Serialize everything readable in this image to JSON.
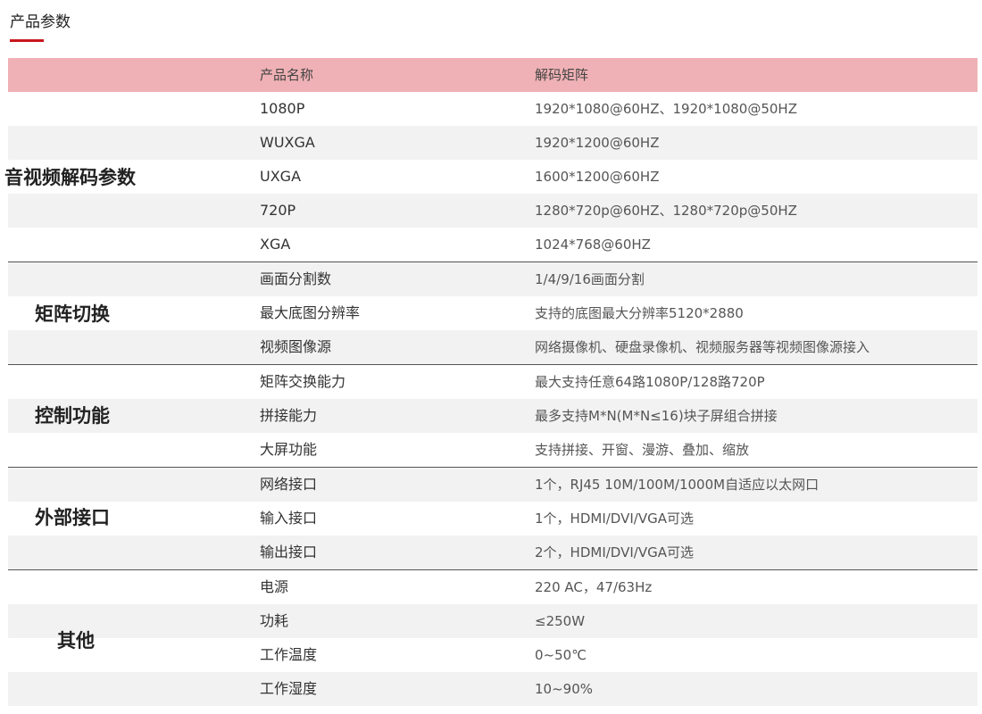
{
  "page_title": "产品参数",
  "header": {
    "name": "产品名称",
    "value": "解码矩阵"
  },
  "groups": [
    {
      "label": "音视频解码参数"
    },
    {
      "label": "矩阵切换"
    },
    {
      "label": "控制功能"
    },
    {
      "label": "外部接口"
    },
    {
      "label": "其他"
    }
  ],
  "rows": [
    {
      "name": "1080P",
      "value": "1920*1080@60HZ、1920*1080@50HZ"
    },
    {
      "name": "WUXGA",
      "value": "1920*1200@60HZ"
    },
    {
      "name": "UXGA",
      "value": "1600*1200@60HZ"
    },
    {
      "name": "720P",
      "value": "1280*720p@60HZ、1280*720p@50HZ"
    },
    {
      "name": "XGA",
      "value": "1024*768@60HZ"
    },
    {
      "name": "画面分割数",
      "value": "1/4/9/16画面分割"
    },
    {
      "name": "最大底图分辨率",
      "value": "支持的底图最大分辨率5120*2880"
    },
    {
      "name": "视频图像源",
      "value": "网络摄像机、硬盘录像机、视频服务器等视频图像源接入"
    },
    {
      "name": "矩阵交换能力",
      "value": "最大支持任意64路1080P/128路720P"
    },
    {
      "name": "拼接能力",
      "value": "最多支持M*N(M*N≤16)块子屏组合拼接"
    },
    {
      "name": "大屏功能",
      "value": "支持拼接、开窗、漫游、叠加、缩放"
    },
    {
      "name": "网络接口",
      "value": "1个，RJ45 10M/100M/1000M自适应以太网口"
    },
    {
      "name": "输入接口",
      "value": "1个，HDMI/DVI/VGA可选"
    },
    {
      "name": "输出接口",
      "value": "2个，HDMI/DVI/VGA可选"
    },
    {
      "name": "电源",
      "value": "220 AC，47/63Hz"
    },
    {
      "name": "功耗",
      "value": "≤250W"
    },
    {
      "name": "工作温度",
      "value": "0~50℃"
    },
    {
      "name": "工作湿度",
      "value": "10~90%"
    }
  ],
  "colors": {
    "accent": "#c8161d",
    "header_bg": "#efb1b5",
    "row_shade": "#f2f2f2",
    "divider": "#555555"
  }
}
